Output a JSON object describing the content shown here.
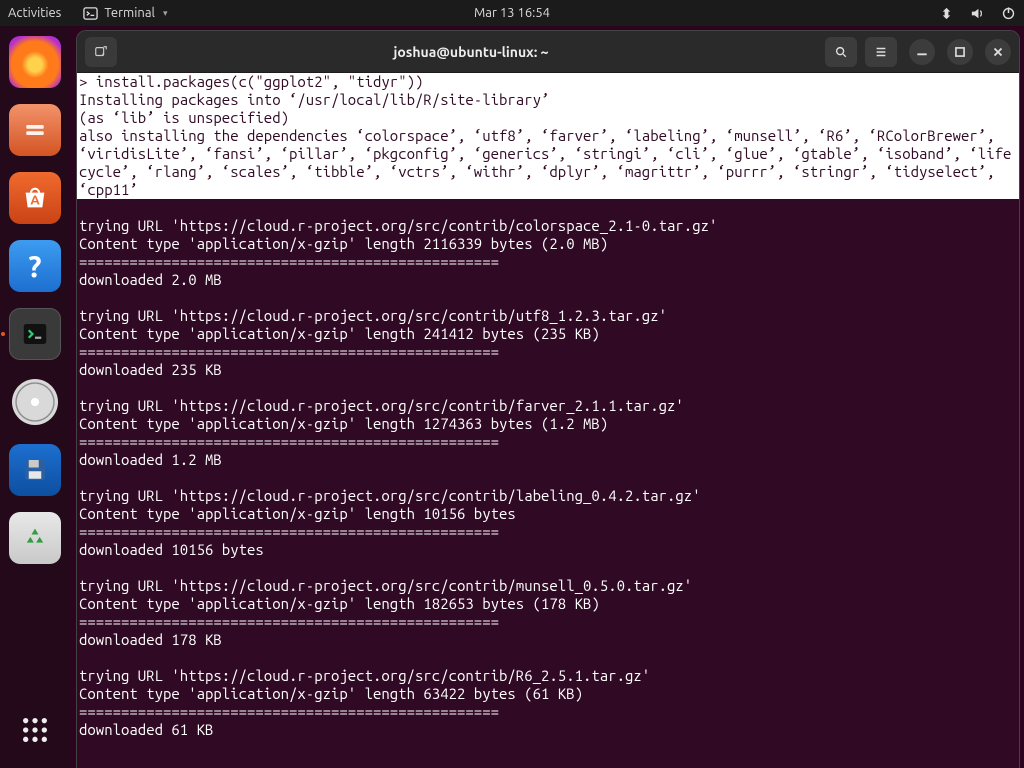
{
  "topbar": {
    "activities": "Activities",
    "terminal_label": "Terminal",
    "clock": "Mar 13  16:54"
  },
  "window": {
    "title": "joshua@ubuntu-linux: ~"
  },
  "terminal": {
    "selected": "> install.packages(c(\"ggplot2\", \"tidyr\"))\nInstalling packages into ‘/usr/local/lib/R/site-library’\n(as ‘lib’ is unspecified)\nalso installing the dependencies ‘colorspace’, ‘utf8’, ‘farver’, ‘labeling’, ‘munsell’, ‘R6’, ‘RColorBrewer’, ‘viridisLite’, ‘fansi’, ‘pillar’, ‘pkgconfig’, ‘generics’, ‘stringi’, ‘cli’, ‘glue’, ‘gtable’, ‘isoband’, ‘lifecycle’, ‘rlang’, ‘scales’, ‘tibble’, ‘vctrs’, ‘withr’, ‘dplyr’, ‘magrittr’, ‘purrr’, ‘stringr’, ‘tidyselect’, ‘cpp11’\n",
    "rest": "\ntrying URL 'https://cloud.r-project.org/src/contrib/colorspace_2.1-0.tar.gz'\nContent type 'application/x-gzip' length 2116339 bytes (2.0 MB)\n==================================================\ndownloaded 2.0 MB\n\ntrying URL 'https://cloud.r-project.org/src/contrib/utf8_1.2.3.tar.gz'\nContent type 'application/x-gzip' length 241412 bytes (235 KB)\n==================================================\ndownloaded 235 KB\n\ntrying URL 'https://cloud.r-project.org/src/contrib/farver_2.1.1.tar.gz'\nContent type 'application/x-gzip' length 1274363 bytes (1.2 MB)\n==================================================\ndownloaded 1.2 MB\n\ntrying URL 'https://cloud.r-project.org/src/contrib/labeling_0.4.2.tar.gz'\nContent type 'application/x-gzip' length 10156 bytes\n==================================================\ndownloaded 10156 bytes\n\ntrying URL 'https://cloud.r-project.org/src/contrib/munsell_0.5.0.tar.gz'\nContent type 'application/x-gzip' length 182653 bytes (178 KB)\n==================================================\ndownloaded 178 KB\n\ntrying URL 'https://cloud.r-project.org/src/contrib/R6_2.5.1.tar.gz'\nContent type 'application/x-gzip' length 63422 bytes (61 KB)\n==================================================\ndownloaded 61 KB\n"
  },
  "dock": {
    "items": [
      {
        "name": "firefox"
      },
      {
        "name": "files"
      },
      {
        "name": "software"
      },
      {
        "name": "help"
      },
      {
        "name": "terminal"
      },
      {
        "name": "disc"
      },
      {
        "name": "save"
      },
      {
        "name": "trash"
      }
    ]
  }
}
